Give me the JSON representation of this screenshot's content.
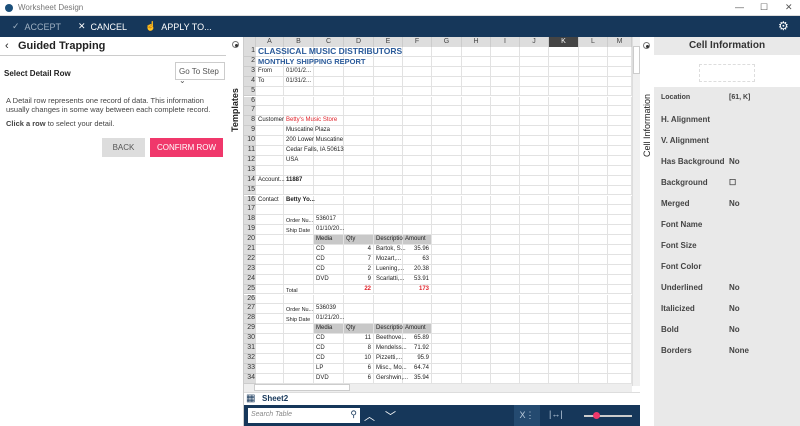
{
  "window": {
    "title": "Worksheet Design"
  },
  "toolbar": {
    "accept": "ACCEPT",
    "cancel": "CANCEL",
    "apply": "APPLY TO..."
  },
  "left": {
    "title": "Guided Trapping",
    "section": "Select Detail Row",
    "goto": "Go To Step",
    "desc1": "A Detail row represents one record of data. This information",
    "desc2": "usually changes in some way between each complete record.",
    "click_bold": "Click a row",
    "click_rest": " to select your detail.",
    "back": "BACK",
    "confirm": "CONFIRM ROW"
  },
  "templates_label": "Templates",
  "grid": {
    "columns": [
      "A",
      "B",
      "C",
      "D",
      "E",
      "F",
      "G",
      "H",
      "I",
      "J",
      "K",
      "L",
      "M"
    ],
    "selected_column": "K",
    "row_count": 34,
    "cells": [
      [
        1,
        "A",
        "CLASSICAL MUSIC DISTRIBUTORS",
        "title"
      ],
      [
        2,
        "A",
        "MONTHLY SHIPPING REPORT",
        "subtitle"
      ],
      [
        3,
        "A",
        "From"
      ],
      [
        3,
        "B",
        "01/01/2..."
      ],
      [
        4,
        "A",
        "To"
      ],
      [
        4,
        "B",
        "01/31/2..."
      ],
      [
        8,
        "A",
        "Customer"
      ],
      [
        8,
        "B",
        "Betty's Music Store",
        "red"
      ],
      [
        9,
        "B",
        "Muscatine Plaza"
      ],
      [
        10,
        "B",
        "200 Lower Muscatine"
      ],
      [
        11,
        "B",
        "Cedar Falls, IA 50613"
      ],
      [
        12,
        "B",
        "USA"
      ],
      [
        14,
        "A",
        "Account..."
      ],
      [
        14,
        "B",
        "11887",
        "bold"
      ],
      [
        16,
        "A",
        "Contact"
      ],
      [
        16,
        "B",
        "Betty Yo...",
        "bold"
      ],
      [
        18,
        "B",
        "Order Nu...",
        "small"
      ],
      [
        18,
        "C",
        "536017"
      ],
      [
        19,
        "B",
        "Ship Date",
        "small"
      ],
      [
        19,
        "C",
        "01/10/20..."
      ],
      [
        20,
        "C",
        "Media",
        "hdr"
      ],
      [
        20,
        "D",
        "Qty",
        "hdr"
      ],
      [
        20,
        "E",
        "Description",
        "hdr"
      ],
      [
        20,
        "F",
        "Amount",
        "hdr"
      ],
      [
        21,
        "C",
        "CD"
      ],
      [
        21,
        "D",
        "4",
        "num"
      ],
      [
        21,
        "E",
        "Bartok, S..."
      ],
      [
        21,
        "F",
        "35.96",
        "num"
      ],
      [
        22,
        "C",
        "CD"
      ],
      [
        22,
        "D",
        "7",
        "num"
      ],
      [
        22,
        "E",
        "Mozart,..."
      ],
      [
        22,
        "F",
        "63",
        "num"
      ],
      [
        23,
        "C",
        "CD"
      ],
      [
        23,
        "D",
        "2",
        "num"
      ],
      [
        23,
        "E",
        "Luening,..."
      ],
      [
        23,
        "F",
        "20.38",
        "num"
      ],
      [
        24,
        "C",
        "DVD"
      ],
      [
        24,
        "D",
        "9",
        "num"
      ],
      [
        24,
        "E",
        "Scarlatti,..."
      ],
      [
        24,
        "F",
        "53.91",
        "num"
      ],
      [
        25,
        "B",
        "Total",
        "small"
      ],
      [
        25,
        "D",
        "22",
        "rednum"
      ],
      [
        25,
        "F",
        "173",
        "rednum"
      ],
      [
        27,
        "B",
        "Order Nu...",
        "small"
      ],
      [
        27,
        "C",
        "536039"
      ],
      [
        28,
        "B",
        "Ship Date",
        "small"
      ],
      [
        28,
        "C",
        "01/21/20..."
      ],
      [
        29,
        "C",
        "Media",
        "hdr"
      ],
      [
        29,
        "D",
        "Qty",
        "hdr"
      ],
      [
        29,
        "E",
        "Description",
        "hdr"
      ],
      [
        29,
        "F",
        "Amount",
        "hdr"
      ],
      [
        30,
        "C",
        "CD"
      ],
      [
        30,
        "D",
        "11",
        "num"
      ],
      [
        30,
        "E",
        "Beethove..."
      ],
      [
        30,
        "F",
        "65.89",
        "num"
      ],
      [
        31,
        "C",
        "CD"
      ],
      [
        31,
        "D",
        "8",
        "num"
      ],
      [
        31,
        "E",
        "Mendelss..."
      ],
      [
        31,
        "F",
        "71.92",
        "num"
      ],
      [
        32,
        "C",
        "CD"
      ],
      [
        32,
        "D",
        "10",
        "num"
      ],
      [
        32,
        "E",
        "Pizzetti,..."
      ],
      [
        32,
        "F",
        "95.9",
        "num"
      ],
      [
        33,
        "C",
        "LP"
      ],
      [
        33,
        "D",
        "6",
        "num"
      ],
      [
        33,
        "E",
        "Misc., Mo..."
      ],
      [
        33,
        "F",
        "64.74",
        "num"
      ],
      [
        34,
        "C",
        "DVD"
      ],
      [
        34,
        "D",
        "6",
        "num"
      ],
      [
        34,
        "E",
        "Gershwin,..."
      ],
      [
        34,
        "F",
        "35.94",
        "num"
      ]
    ]
  },
  "sheet_tab": "Sheet2",
  "search": {
    "placeholder": "Search Table"
  },
  "zoom_level": 0.25,
  "cellinfo": {
    "strip_label": "Cell Information",
    "title": "Cell Information",
    "props": [
      {
        "label": "Location",
        "value": "[61, K]"
      },
      {
        "label": "H. Alignment",
        "value": ""
      },
      {
        "label": "V. Alignment",
        "value": ""
      },
      {
        "label": "Has Background",
        "value": "No"
      },
      {
        "label": "Background",
        "value": "☐"
      },
      {
        "label": "Merged",
        "value": "No"
      },
      {
        "label": "Font Name",
        "value": ""
      },
      {
        "label": "Font Size",
        "value": ""
      },
      {
        "label": "Font Color",
        "value": ""
      },
      {
        "label": "Underlined",
        "value": "No"
      },
      {
        "label": "Italicized",
        "value": "No"
      },
      {
        "label": "Bold",
        "value": "No"
      },
      {
        "label": "Borders",
        "value": "None"
      }
    ]
  },
  "colors": {
    "toolbar": "#16375a",
    "confirm": "#f0386b",
    "title_blue": "#2b5b9a",
    "red": "#e0222a"
  }
}
